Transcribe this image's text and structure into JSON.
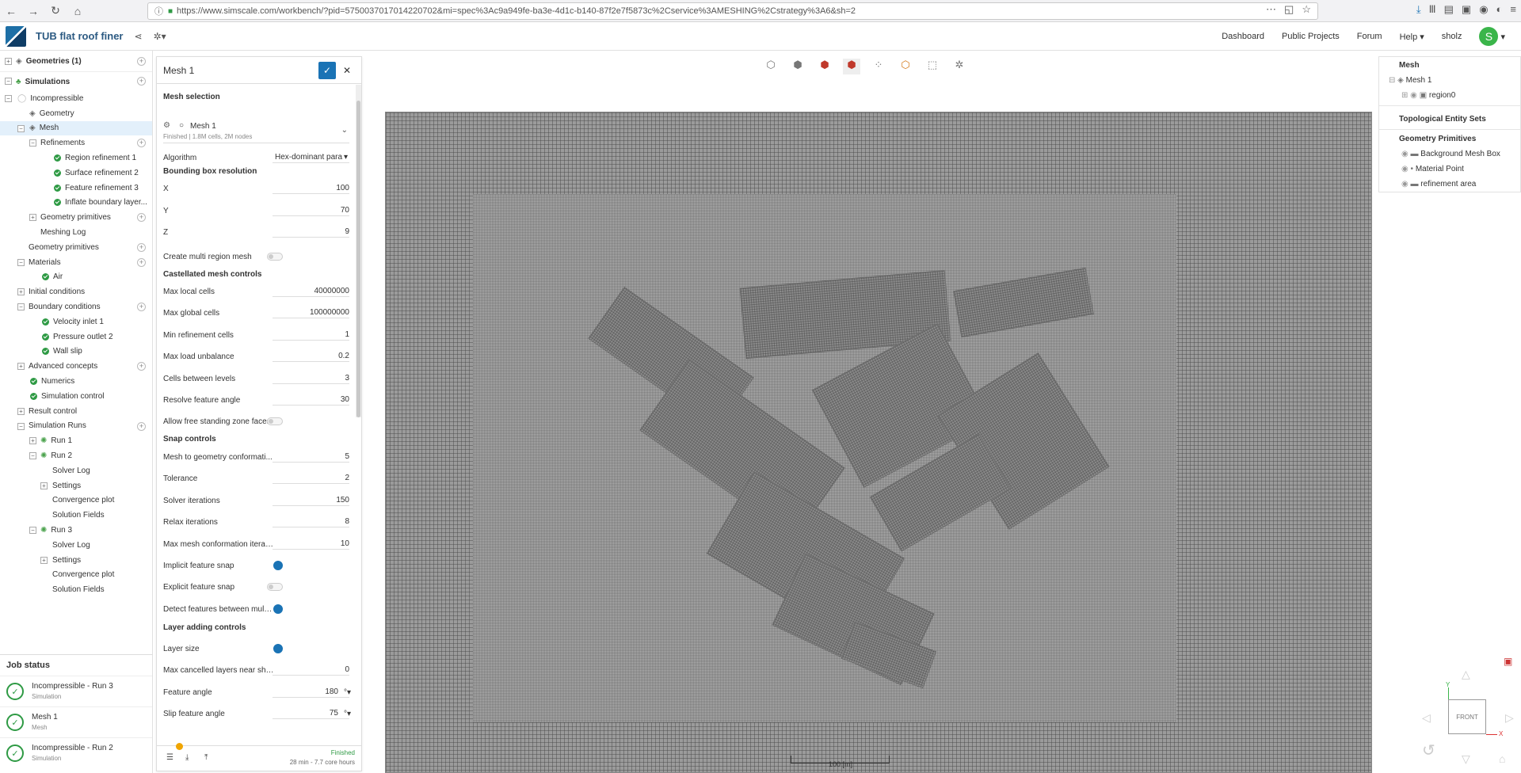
{
  "browser": {
    "url": "https://www.simscale.com/workbench/?pid=5750037017014220702&mi=spec%3Ac9a949fe-ba3e-4d1c-b140-87f2e7f5873c%2Cservice%3AMESHING%2Cstrategy%3A6&sh=2"
  },
  "header": {
    "project_title": "TUB flat roof finer",
    "nav": [
      "Dashboard",
      "Public Projects",
      "Forum",
      "Help"
    ],
    "user": "sholz",
    "avatar_letter": "S"
  },
  "tree": {
    "geometries": "Geometries (1)",
    "simulations": "Simulations",
    "incompressible": "Incompressible",
    "geometry": "Geometry",
    "mesh": "Mesh",
    "refinements": "Refinements",
    "refinement_items": [
      "Region refinement 1",
      "Surface refinement 2",
      "Feature refinement 3",
      "Inflate boundary layer..."
    ],
    "geometry_primitives_sub": "Geometry primitives",
    "meshing_log": "Meshing Log",
    "geometry_primitives": "Geometry primitives",
    "materials": "Materials",
    "air": "Air",
    "initial_conditions": "Initial conditions",
    "boundary_conditions": "Boundary conditions",
    "bc_items": [
      "Velocity inlet 1",
      "Pressure outlet 2",
      "Wall slip"
    ],
    "advanced_concepts": "Advanced concepts",
    "numerics": "Numerics",
    "simulation_control": "Simulation control",
    "result_control": "Result control",
    "simulation_runs": "Simulation Runs",
    "run1": "Run 1",
    "run2": "Run 2",
    "run3": "Run 3",
    "solver_log": "Solver Log",
    "settings": "Settings",
    "convergence_plot": "Convergence plot",
    "solution_fields": "Solution Fields"
  },
  "jobs": {
    "title": "Job status",
    "items": [
      {
        "name": "Incompressible - Run 3",
        "type": "Simulation"
      },
      {
        "name": "Mesh 1",
        "type": "Mesh"
      },
      {
        "name": "Incompressible - Run 2",
        "type": "Simulation"
      }
    ]
  },
  "panel": {
    "title": "Mesh 1",
    "mesh_selection": "Mesh selection",
    "mesh_name": "Mesh 1",
    "mesh_info": "Finished | 1.8M cells, 2M nodes",
    "algorithm_label": "Algorithm",
    "algorithm_value": "Hex-dominant para",
    "bbox_title": "Bounding box resolution",
    "x_label": "X",
    "x_value": "100",
    "y_label": "Y",
    "y_value": "70",
    "z_label": "Z",
    "z_value": "9",
    "multi_region": "Create multi region mesh",
    "castellated_title": "Castellated mesh controls",
    "max_local_label": "Max local cells",
    "max_local_value": "40000000",
    "max_global_label": "Max global cells",
    "max_global_value": "100000000",
    "min_ref_label": "Min refinement cells",
    "min_ref_value": "1",
    "max_load_label": "Max load unbalance",
    "max_load_value": "0.2",
    "cells_between_label": "Cells between levels",
    "cells_between_value": "3",
    "resolve_angle_label": "Resolve feature angle",
    "resolve_angle_value": "30",
    "free_standing": "Allow free standing zone faces",
    "snap_title": "Snap controls",
    "mesh_to_geo_label": "Mesh to geometry conformati...",
    "mesh_to_geo_value": "5",
    "tolerance_label": "Tolerance",
    "tolerance_value": "2",
    "solver_iter_label": "Solver iterations",
    "solver_iter_value": "150",
    "relax_iter_label": "Relax iterations",
    "relax_iter_value": "8",
    "max_conf_label": "Max mesh conformation iterat...",
    "max_conf_value": "10",
    "implicit_snap": "Implicit feature snap",
    "explicit_snap": "Explicit feature snap",
    "detect_features": "Detect features between multi...",
    "layer_title": "Layer adding controls",
    "layer_size": "Layer size",
    "max_cancelled_label": "Max cancelled layers near shar...",
    "max_cancelled_value": "0",
    "feature_angle_label": "Feature angle",
    "feature_angle_value": "180",
    "slip_angle_label": "Slip feature angle",
    "slip_angle_value": "75",
    "degree_unit": "°",
    "status": "Finished",
    "duration": "28 min - 7.7 core hours"
  },
  "viewport": {
    "scale_label": "100 [m]",
    "view_label": "FRONT",
    "axis_y": "Y",
    "axis_x": "X"
  },
  "entities": {
    "mesh": "Mesh",
    "mesh1": "Mesh 1",
    "region0": "region0",
    "topo_sets": "Topological Entity Sets",
    "geo_primitives": "Geometry Primitives",
    "items": [
      "Background Mesh Box",
      "Material Point",
      "refinement area"
    ]
  }
}
